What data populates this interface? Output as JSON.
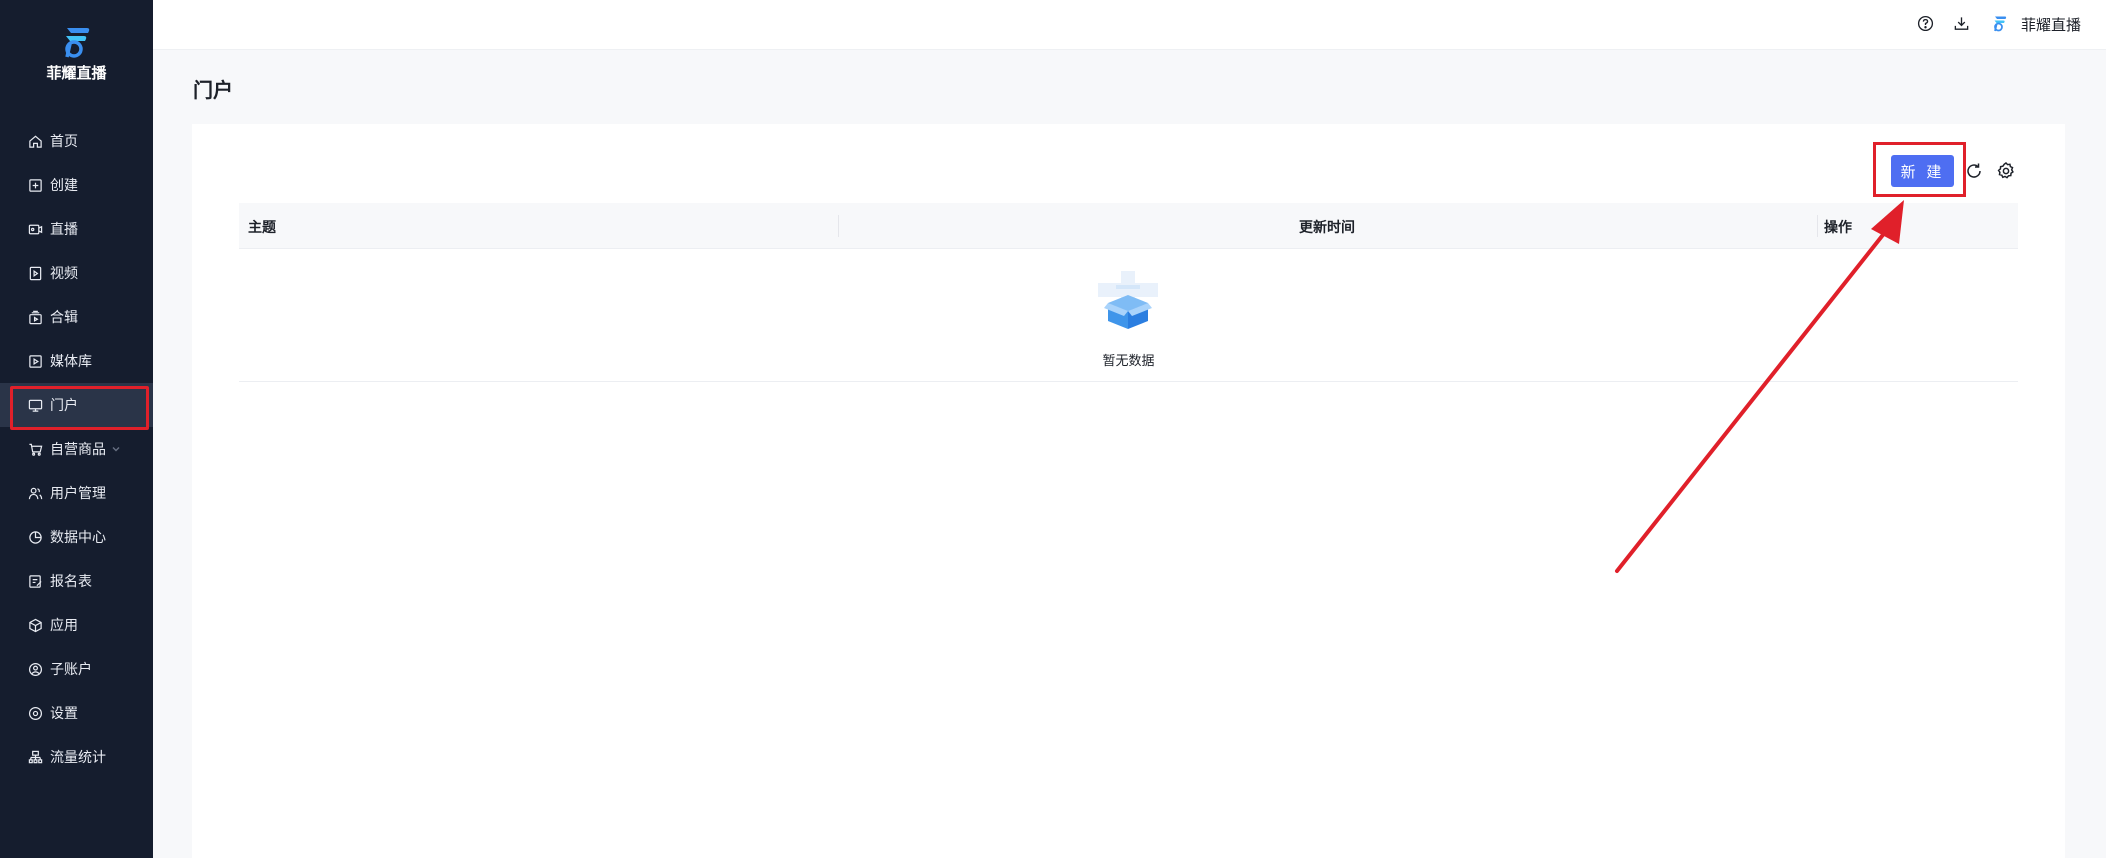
{
  "sidebar": {
    "brand_name": "菲耀直播",
    "items": [
      {
        "label": "首页",
        "icon": "home-icon"
      },
      {
        "label": "创建",
        "icon": "add-square-icon"
      },
      {
        "label": "直播",
        "icon": "live-camera-icon"
      },
      {
        "label": "视频",
        "icon": "video-file-icon"
      },
      {
        "label": "合辑",
        "icon": "collection-icon"
      },
      {
        "label": "媒体库",
        "icon": "media-library-icon"
      },
      {
        "label": "门户",
        "icon": "monitor-icon",
        "active": true
      },
      {
        "label": "自营商品",
        "icon": "cart-icon",
        "has_submenu": true
      },
      {
        "label": "用户管理",
        "icon": "users-icon"
      },
      {
        "label": "数据中心",
        "icon": "pie-chart-icon"
      },
      {
        "label": "报名表",
        "icon": "form-edit-icon"
      },
      {
        "label": "应用",
        "icon": "app-cube-icon"
      },
      {
        "label": "子账户",
        "icon": "account-icon"
      },
      {
        "label": "设置",
        "icon": "settings-icon"
      },
      {
        "label": "流量统计",
        "icon": "traffic-stats-icon"
      }
    ]
  },
  "topbar": {
    "help_icon": "help-circle-icon",
    "download_icon": "download-icon",
    "username": "菲耀直播"
  },
  "page": {
    "title": "门户",
    "toolbar": {
      "new_label": "新 建",
      "refresh_icon": "refresh-icon",
      "settings_icon": "settings-gear-icon"
    },
    "table": {
      "columns": [
        "主题",
        "更新时间",
        "操作"
      ],
      "rows": [],
      "empty_text": "暂无数据"
    }
  },
  "colors": {
    "sidebar_bg": "#151d2e",
    "sidebar_active": "#2a3448",
    "primary": "#4e6ef2",
    "annotation_red": "#e0202a"
  }
}
